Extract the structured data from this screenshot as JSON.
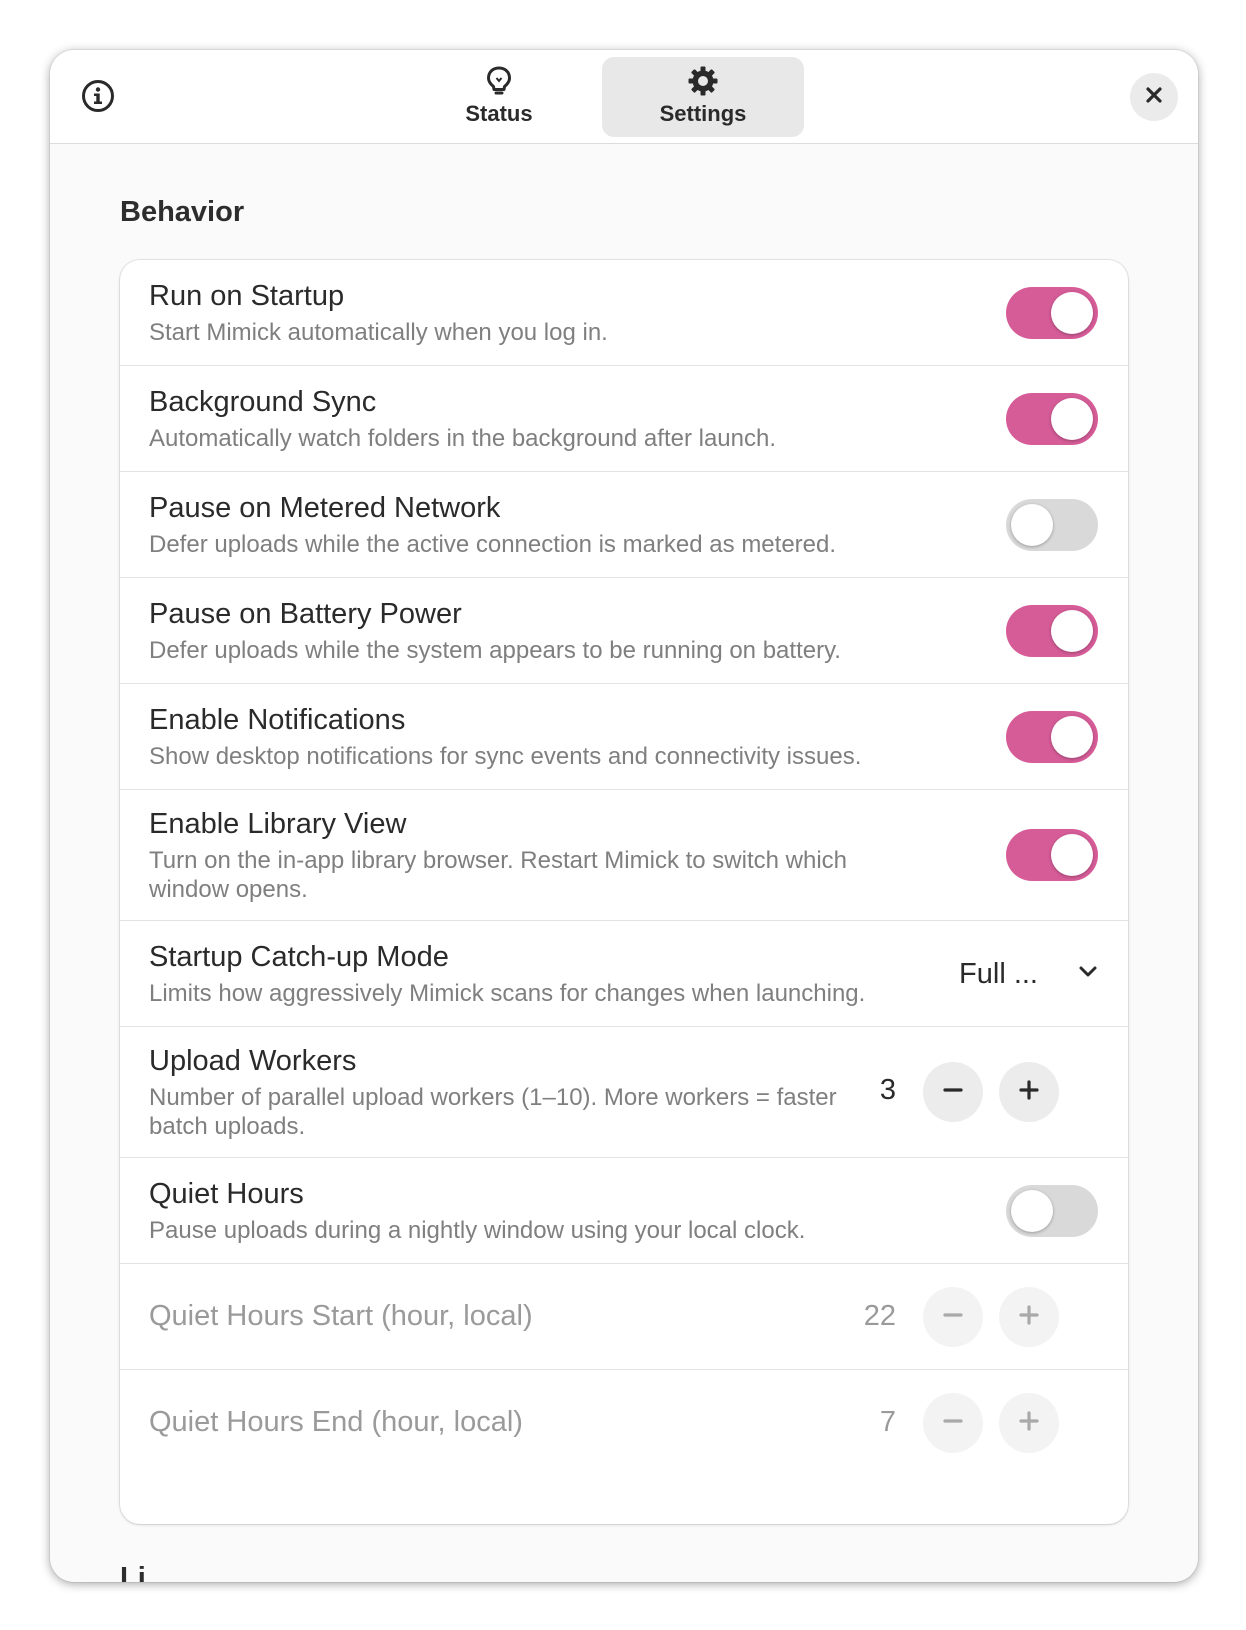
{
  "header": {
    "tabs": [
      {
        "label": "Status",
        "icon": "lightbulb-icon",
        "active": false
      },
      {
        "label": "Settings",
        "icon": "gear-icon",
        "active": true
      }
    ],
    "info_icon": "info-icon",
    "close_icon": "close-icon"
  },
  "section": {
    "title": "Behavior",
    "next_title": "Li"
  },
  "rows": {
    "run_on_startup": {
      "title": "Run on Startup",
      "subtitle": "Start Mimick automatically when you log in.",
      "enabled": true
    },
    "background_sync": {
      "title": "Background Sync",
      "subtitle": "Automatically watch folders in the background after launch.",
      "enabled": true
    },
    "pause_metered": {
      "title": "Pause on Metered Network",
      "subtitle": "Defer uploads while the active connection is marked as metered.",
      "enabled": false
    },
    "pause_battery": {
      "title": "Pause on Battery Power",
      "subtitle": "Defer uploads while the system appears to be running on battery.",
      "enabled": true
    },
    "notifications": {
      "title": "Enable Notifications",
      "subtitle": "Show desktop notifications for sync events and connectivity issues.",
      "enabled": true
    },
    "library_view": {
      "title": "Enable Library View",
      "subtitle": "Turn on the in-app library browser. Restart Mimick to switch which window opens.",
      "enabled": true
    },
    "catchup_mode": {
      "title": "Startup Catch-up Mode",
      "subtitle": "Limits how aggressively Mimick scans for changes when launching.",
      "value": "Full ..."
    },
    "upload_workers": {
      "title": "Upload Workers",
      "subtitle": "Number of parallel upload workers (1–10). More workers = faster batch uploads.",
      "value": "3"
    },
    "quiet_hours": {
      "title": "Quiet Hours",
      "subtitle": "Pause uploads during a nightly window using your local clock.",
      "enabled": false
    },
    "quiet_start": {
      "title": "Quiet Hours Start (hour, local)",
      "value": "22"
    },
    "quiet_end": {
      "title": "Quiet Hours End (hour, local)",
      "value": "7"
    }
  },
  "colors": {
    "accent": "#d65c98",
    "switch_off": "#d9d9d9"
  }
}
